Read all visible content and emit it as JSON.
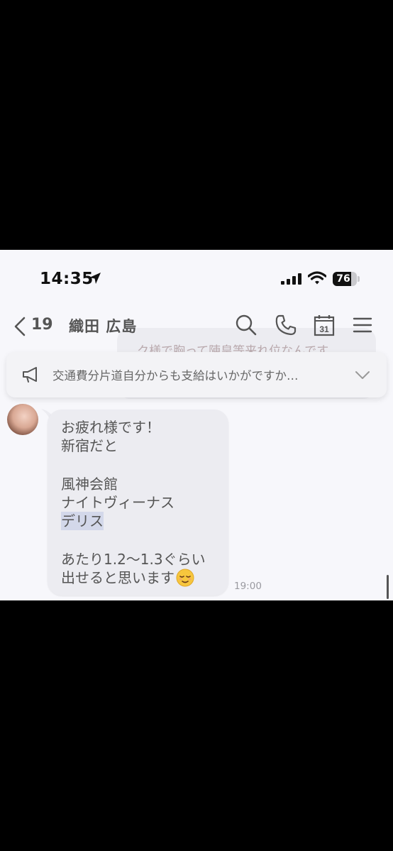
{
  "status_bar": {
    "time": "14:35",
    "battery": "76",
    "battery_level": 0.76
  },
  "header": {
    "back_count": "19",
    "title": "織田 広島"
  },
  "previous_message": {
    "partial_text": "ク様で胸って陣皇等来れ位なんです"
  },
  "announcement": {
    "text": "交通費分片道自分からも支給はいかがですか…"
  },
  "message": {
    "lines": [
      "お疲れ様です！",
      "新宿だと",
      "",
      "風神会館",
      "ナイトヴィーナス",
      "デリス",
      "",
      "あたり1.2〜1.3ぐらい",
      "出せると思います"
    ],
    "emoji": "relieved-face",
    "time": "19:00"
  },
  "colors": {
    "background": "#f7f7fb",
    "bubble": "#ececf1",
    "text": "#555555",
    "selection": "#d3d8ea"
  }
}
